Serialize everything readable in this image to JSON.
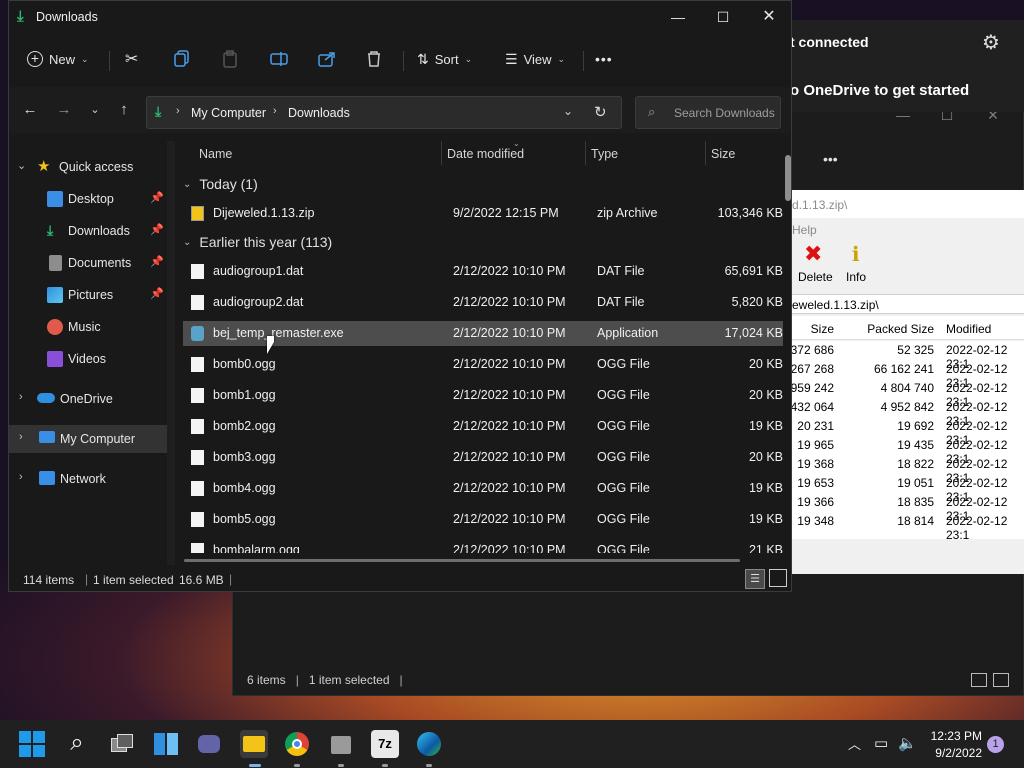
{
  "background_window": {
    "status_items": "6 items",
    "status_selected": "1 item selected",
    "minimize": "—",
    "maximize": "☐",
    "close": "✕",
    "more_icon": "•••"
  },
  "onedrive": {
    "status": "t connected",
    "message": "o OneDrive to get started",
    "settings_icon": "⚙"
  },
  "zip_window": {
    "title": "d.1.13.zip\\",
    "menu_help": "Help",
    "delete_label": "Delete",
    "info_label": "Info",
    "path": "eweled.1.13.zip\\",
    "col_size": "Size",
    "col_packed": "Packed Size",
    "col_modified": "Modified",
    "rows": [
      {
        "size": "372 686",
        "packed": "52 325",
        "modified": "2022-02-12 23:1"
      },
      {
        "size": "267 268",
        "packed": "66 162 241",
        "modified": "2022-02-12 23:1"
      },
      {
        "size": "959 242",
        "packed": "4 804 740",
        "modified": "2022-02-12 23:1"
      },
      {
        "size": "432 064",
        "packed": "4 952 842",
        "modified": "2022-02-12 23:1"
      },
      {
        "size": "20 231",
        "packed": "19 692",
        "modified": "2022-02-12 23:1"
      },
      {
        "size": "19 965",
        "packed": "19 435",
        "modified": "2022-02-12 23:1"
      },
      {
        "size": "19 368",
        "packed": "18 822",
        "modified": "2022-02-12 23:1"
      },
      {
        "size": "19 653",
        "packed": "19 051",
        "modified": "2022-02-12 23:1"
      },
      {
        "size": "19 366",
        "packed": "18 835",
        "modified": "2022-02-12 23:1"
      },
      {
        "size": "19 348",
        "packed": "18 814",
        "modified": "2022-02-12 23:1"
      }
    ]
  },
  "explorer": {
    "title": "Downloads",
    "window_buttons": {
      "minimize": "—",
      "maximize": "☐",
      "close": "✕"
    },
    "toolbar": {
      "new_label": "New",
      "sort_label": "Sort",
      "view_label": "View",
      "more_label": "•••"
    },
    "address": {
      "segments": [
        "My Computer",
        "Downloads"
      ],
      "search_placeholder": "Search Downloads"
    },
    "sidebar": {
      "items": [
        {
          "label": "Quick access",
          "icon": "star-icon",
          "color": "#f3c317"
        },
        {
          "label": "Desktop",
          "icon": "desktop-icon",
          "color": "#3a8ee6"
        },
        {
          "label": "Downloads",
          "icon": "download-icon",
          "color": "#2bb673"
        },
        {
          "label": "Documents",
          "icon": "documents-icon",
          "color": "#8d8d8d"
        },
        {
          "label": "Pictures",
          "icon": "pictures-icon",
          "color": "#2f8fe0"
        },
        {
          "label": "Music",
          "icon": "music-icon",
          "color": "#e05b4a"
        },
        {
          "label": "Videos",
          "icon": "videos-icon",
          "color": "#8a4fd8"
        },
        {
          "label": "OneDrive",
          "icon": "cloud-icon",
          "color": "#2f8fe0"
        },
        {
          "label": "My Computer",
          "icon": "computer-icon",
          "color": "#3a8ee6"
        },
        {
          "label": "Network",
          "icon": "network-icon",
          "color": "#3a8ee6"
        }
      ]
    },
    "columns": {
      "name": "Name",
      "date": "Date modified",
      "type": "Type",
      "size": "Size"
    },
    "groups": {
      "today": "Today (1)",
      "earlier": "Earlier this year (113)"
    },
    "files_today": [
      {
        "name": "Dijeweled.1.13.zip",
        "date": "9/2/2022 12:15 PM",
        "type": "zip Archive",
        "size": "103,346 KB"
      }
    ],
    "files_earlier": [
      {
        "name": "audiogroup1.dat",
        "date": "2/12/2022 10:10 PM",
        "type": "DAT File",
        "size": "65,691 KB"
      },
      {
        "name": "audiogroup2.dat",
        "date": "2/12/2022 10:10 PM",
        "type": "DAT File",
        "size": "5,820 KB"
      },
      {
        "name": "bej_temp_remaster.exe",
        "date": "2/12/2022 10:10 PM",
        "type": "Application",
        "size": "17,024 KB"
      },
      {
        "name": "bomb0.ogg",
        "date": "2/12/2022 10:10 PM",
        "type": "OGG File",
        "size": "20 KB"
      },
      {
        "name": "bomb1.ogg",
        "date": "2/12/2022 10:10 PM",
        "type": "OGG File",
        "size": "20 KB"
      },
      {
        "name": "bomb2.ogg",
        "date": "2/12/2022 10:10 PM",
        "type": "OGG File",
        "size": "19 KB"
      },
      {
        "name": "bomb3.ogg",
        "date": "2/12/2022 10:10 PM",
        "type": "OGG File",
        "size": "20 KB"
      },
      {
        "name": "bomb4.ogg",
        "date": "2/12/2022 10:10 PM",
        "type": "OGG File",
        "size": "19 KB"
      },
      {
        "name": "bomb5.ogg",
        "date": "2/12/2022 10:10 PM",
        "type": "OGG File",
        "size": "19 KB"
      },
      {
        "name": "bombalarm.ogg",
        "date": "2/12/2022 10:10 PM",
        "type": "OGG File",
        "size": "21 KB"
      }
    ],
    "status": {
      "items": "114 items",
      "selected": "1 item selected",
      "size": "16.6 MB"
    }
  },
  "taskbar": {
    "time": "12:23 PM",
    "date": "9/2/2022",
    "notification_count": "1",
    "apps": [
      "start-icon",
      "search-icon",
      "task-view-icon",
      "widgets-icon",
      "teams-icon",
      "file-explorer-icon",
      "chrome-icon",
      "app-icon",
      "7zip-icon",
      "edge-icon"
    ]
  }
}
